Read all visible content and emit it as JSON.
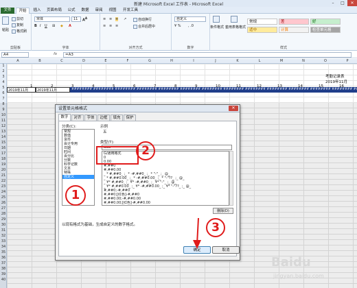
{
  "window": {
    "title": "新建 Microsoft Excel 工作表 - Microsoft Excel"
  },
  "tabs": [
    "文件",
    "开始",
    "插入",
    "页面布局",
    "公式",
    "数据",
    "审阅",
    "视图",
    "开发工具"
  ],
  "ribbon": {
    "clipboard": {
      "paste": "粘贴",
      "cut": "剪切",
      "copy": "复制",
      "format_painter": "格式刷",
      "label": "剪贴板"
    },
    "font": {
      "name": "宋体",
      "size": "11",
      "label": "字体"
    },
    "align": {
      "wrap": "自动换行",
      "merge": "合并后居中",
      "label": "对齐方式"
    },
    "number": {
      "format": "自定义",
      "label": "数字"
    },
    "styles": {
      "conditional": "条件格式",
      "table": "套用表格格式",
      "normal": "常规",
      "bad": "差",
      "good": "好",
      "neutral": "适中",
      "calc": "计算",
      "check": "检查单元格",
      "label": "样式"
    }
  },
  "formula_bar": {
    "name_box": "A4",
    "fx": "fx",
    "formula": "=A3"
  },
  "sheet": {
    "columns": [
      "A",
      "B",
      "C",
      "D",
      "E",
      "F",
      "G",
      "H",
      "I",
      "J",
      "K",
      "L",
      "M",
      "N",
      "O",
      "P"
    ],
    "rows": [
      "1",
      "2",
      "3",
      "4",
      "5",
      "6",
      "7",
      "8",
      "9",
      "10",
      "11",
      "12",
      "13",
      "14",
      "15",
      "16",
      "17",
      "18",
      "19",
      "20",
      "21",
      "22",
      "23",
      "24",
      "25",
      "26",
      "27",
      "28",
      "29",
      "30",
      "31",
      "32",
      "33",
      "34",
      "35",
      "36",
      "37",
      "38",
      "39",
      "40"
    ],
    "title_cell": "考勤记录表",
    "month_cell": "2019年11月",
    "day_numbers": [
      "1",
      "2",
      "3",
      "4",
      "5",
      "6",
      "7",
      "8",
      "9",
      "10",
      "11",
      "12",
      "13",
      "14",
      "15",
      "16"
    ],
    "row3_date": "2019年11月",
    "row3_b": "2019年11月",
    "row3_hashes": "######## ######## ######## ######## ######## ######## ######## ######## ######## ######## ######## ######## ######## ######## ######## ######## ######## ########"
  },
  "dialog": {
    "title": "设置单元格格式",
    "close": "✕",
    "tabs": [
      "数字",
      "对齐",
      "字体",
      "边框",
      "填充",
      "保护"
    ],
    "category_label": "分类(C):",
    "categories": [
      "常规",
      "数值",
      "货币",
      "会计专用",
      "日期",
      "时间",
      "百分比",
      "分数",
      "科学记数",
      "文本",
      "特殊",
      "自定义"
    ],
    "selected_category": "自定义",
    "sample_label": "示例",
    "sample_value": "五",
    "type_label": "类型(T):",
    "type_value": "aaa",
    "type_list": [
      "G/通用格式",
      "0",
      "0.00",
      "#,##0",
      "#,##0.00",
      "_ * #,##0_ ;_ * -#,##0_ ;_ * \"-\"_ ;_ @_",
      "_ * #,##0.00_ ;_ * -#,##0.00_ ;_ * \"-\"??_ ;_ @_",
      "_ ¥* #,##0_ ;_ ¥* -#,##0_ ;_ ¥* \"-\"_ ;_ @_",
      "_ ¥* #,##0.00_ ;_ ¥* -#,##0.00_ ;_ ¥* \"-\"??_ ;_ @_",
      "#,##0;-#,##0",
      "#,##0;[红色]-#,##0",
      "#,##0.00;-#,##0.00",
      "#,##0.00;[红色]-#,##0.00"
    ],
    "delete_button": "删除(D)",
    "description": "以现有格式为基础，生成自定义的数字格式。",
    "ok": "确定",
    "cancel": "取消"
  },
  "annotations": {
    "one": "1",
    "two": "2",
    "three": "3",
    "color": "#e01b1b"
  },
  "watermark": {
    "text": "Baidu",
    "sub": "jingyan.baidu.com"
  }
}
